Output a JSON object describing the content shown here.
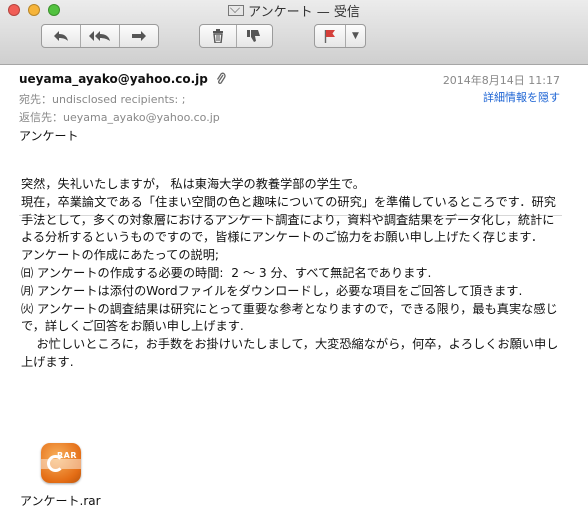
{
  "window": {
    "title": "アンケート — 受信",
    "controls": [
      "close",
      "minimize",
      "zoom"
    ]
  },
  "toolbar": {
    "reply_icon": "reply-icon",
    "reply_all_icon": "reply-all-icon",
    "forward_icon": "forward-icon",
    "delete_icon": "trash-icon",
    "junk_icon": "thumbs-down-icon",
    "flag_icon": "flag-icon",
    "flag_menu_icon": "chevron-down-icon"
  },
  "header": {
    "from": "ueyama_ayako@yahoo.co.jp",
    "attachment_icon": "paperclip-icon",
    "date": "2014年8月14日  11:17",
    "details_link": "詳細情報を隠す",
    "to_label": "宛先：",
    "to_value": "undisclosed recipients: ;",
    "replyto_label": "返信先：",
    "replyto_value": "ueyama_ayako@yahoo.co.jp",
    "subject": "アンケート"
  },
  "body": {
    "text": "突然，失礼いたしますが， 私は東海大学の教養学部の学生で。\n現在，卒業論文である「住まい空間の色と趣味についての研究」を準備しているところです．研究手法として，多くの対象層におけるアンケート調査により，資料や調査結果をデータ化し，統計による分析するというものですので，皆様にアンケートのご協力をお願い申し上げたく存じます．\nアンケートの作成にあたっての説明;\n㈰ アンケートの作成する必要の時間:  2 〜 3 分、すべて無記名であります.\n㈪ アンケートは添付のWordファイルをダウンロードし，必要な項目をご回答して頂きます.\n㈫ アンケートの調査結果は研究にとって重要な参考となりますので，できる限り，最も真実な感じで，詳しくご回答をお願い申し上げます.\n    お忙しいところに，お手数をお掛けいたしまして，大変恐縮ながら，何卒，よろしくお願い申し上げます."
  },
  "attachment": {
    "icon": "rar-archive-icon",
    "icon_text": "RAR",
    "filename": "アンケート.rar"
  },
  "colors": {
    "link": "#1d64d4",
    "secondary_text": "#888888",
    "rar_orange": "#e46d15"
  }
}
